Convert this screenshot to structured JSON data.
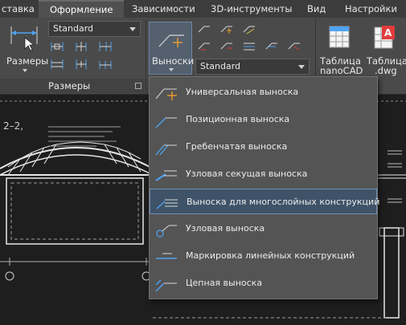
{
  "tabs": [
    {
      "label": "ставка",
      "active": false
    },
    {
      "label": "Оформление",
      "active": true
    },
    {
      "label": "Зависимости",
      "active": false
    },
    {
      "label": "3D-инструменты",
      "active": false
    },
    {
      "label": "Вид",
      "active": false
    },
    {
      "label": "Настройки",
      "active": false
    }
  ],
  "ribbon": {
    "dimensions": {
      "button_label": "Размеры",
      "style_value": "Standard",
      "panel_title": "Размеры"
    },
    "leaders": {
      "button_label": "Выноски",
      "style_value": "Standard"
    },
    "tables": {
      "nanocad_label_1": "Таблица",
      "nanocad_label_2": "nanoCAD",
      "dwg_label_1": "Таблица",
      "dwg_label_2": ".dwg"
    }
  },
  "drawing": {
    "section_label": "2–2,"
  },
  "dropdown": {
    "items": [
      {
        "label": "Универсальная выноска",
        "icon": "universal-leader-icon"
      },
      {
        "label": "Позиционная выноска",
        "icon": "position-leader-icon"
      },
      {
        "label": "Гребенчатая выноска",
        "icon": "comb-leader-icon"
      },
      {
        "label": "Узловая секущая выноска",
        "icon": "node-section-leader-icon"
      },
      {
        "label": "Выноска для многослойных конструкций",
        "icon": "multilayer-leader-icon",
        "highlighted": true
      },
      {
        "label": "Узловая выноска",
        "icon": "node-leader-icon"
      },
      {
        "label": "Маркировка линейных конструкций",
        "icon": "linear-marking-icon"
      },
      {
        "label": "Цепная выноска",
        "icon": "chain-leader-icon"
      }
    ]
  },
  "colors": {
    "ribbon_bg": "#4a4a4a",
    "highlight_bg": "#3f5368",
    "accent_blue": "#4fa3f0",
    "accent_orange": "#f0a030",
    "accent_red": "#e23c3c"
  }
}
